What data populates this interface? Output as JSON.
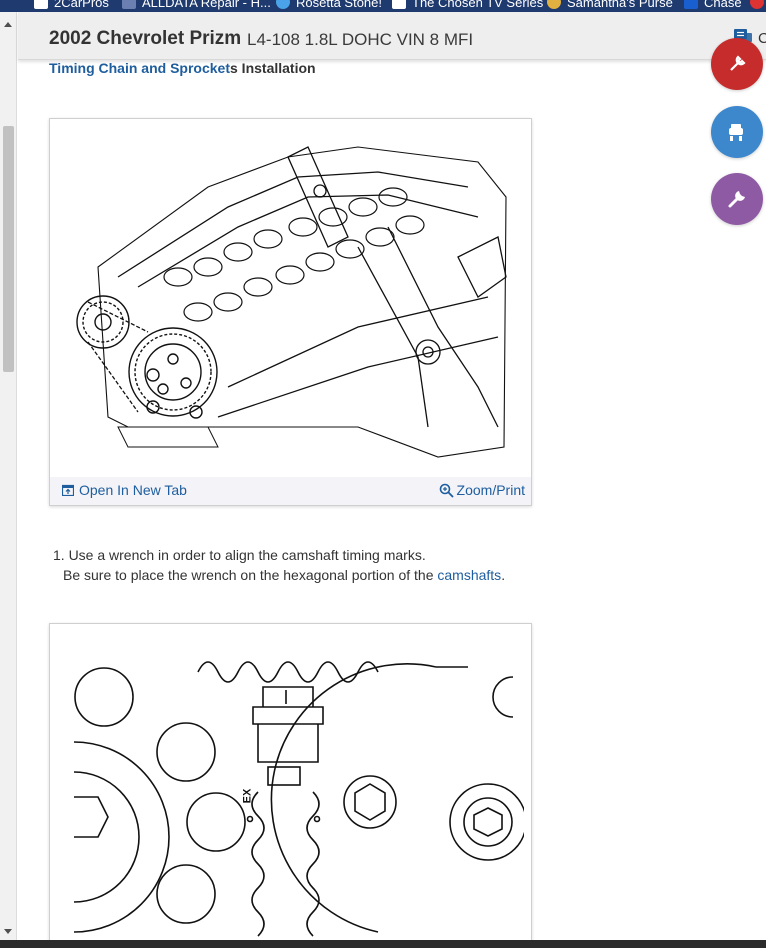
{
  "bookmarks": [
    {
      "label": "2CarPros",
      "color": "#ffffff"
    },
    {
      "label": "ALLDATA Repair - H...",
      "color": "#6b7fb0"
    },
    {
      "label": "Rosetta Stone!",
      "color": "#4aa3e8"
    },
    {
      "label": "The Chosen TV Series",
      "color": "#ffffff"
    },
    {
      "label": "Samantha's Purse",
      "color": "#e0b040"
    },
    {
      "label": "Chase",
      "color": "#1a5fd0"
    }
  ],
  "header": {
    "vehicle": "2002 Chevrolet Prizm",
    "engine": "L4-108 1.8L DOHC VIN 8 MFI",
    "chat_label": "C"
  },
  "breadcrumb": {
    "link": "Timing Chain and Sprocket",
    "rest": "s Installation"
  },
  "figure1": {
    "open_label": "Open In New Tab",
    "zoom_label": "Zoom/Print"
  },
  "steps": {
    "line1": "1. Use a wrench in order to align the camshaft timing marks.",
    "line2_prefix": "Be sure to place the wrench on the hexagonal portion of the ",
    "line2_link": "camshafts",
    "line2_suffix": "."
  },
  "figure2": {
    "mark_label": "EX"
  },
  "fabs": [
    {
      "name": "red-fab",
      "color": "#c62c2c",
      "icon": "wrench-tag-icon"
    },
    {
      "name": "lift-fab",
      "color": "#3d87cc",
      "icon": "car-lift-icon"
    },
    {
      "name": "tools-fab",
      "color": "#8e5aa3",
      "icon": "wrench-icon"
    }
  ]
}
